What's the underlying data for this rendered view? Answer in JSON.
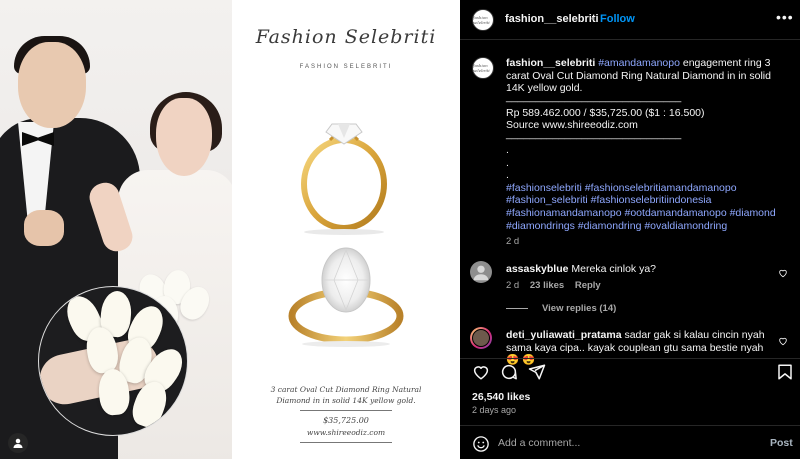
{
  "post": {
    "username": "fashion__selebriti",
    "follow_label": "Follow",
    "dot": "•",
    "more": "•••",
    "avatar_text": "fashion selebriti"
  },
  "media": {
    "brand_script": "Fashion Selebriti",
    "brand_sub": "FASHION SELEBRITI",
    "ring_caption_line1": "3 carat Oval Cut Diamond Ring Natural",
    "ring_caption_line2": "Diamond in in solid 14K yellow gold.",
    "price": "$35,725.00",
    "site": "www.shireeodiz.com"
  },
  "caption": {
    "username": "fashion__selebriti",
    "mention": "#amandamanopo",
    "text": " engagement ring 3 carat Oval Cut Diamond Ring Natural Diamond in in solid 14K yellow gold.",
    "rule1": "______________________________",
    "price_line": "Rp 589.462.000 / $35,725.00 ($1 : 16.500)",
    "source_line": "Source www.shireeodiz.com",
    "rule2": "______________________________",
    "dot1": ".",
    "dot2": ".",
    "dot3": ".",
    "hashtags_line1": "#fashionselebriti #fashionselebritiamandamanopo",
    "hashtags_line2": "#fashion_selebriti #fashionselebritiindonesia",
    "hashtags_line3": "#fashionamandamanopo #ootdamandamanopo #diamond",
    "hashtags_line4": "#diamondrings #diamondring #ovaldiamondring",
    "age": "2 d"
  },
  "comments": [
    {
      "username": "assaskyblue",
      "text": "Mereka cinlok ya?",
      "age": "2 d",
      "likes": "23 likes",
      "reply": "Reply",
      "avatar_color": "#8e8e8e"
    },
    {
      "username": "deti_yuliawati_pratama",
      "text": "sadar gak si kalau cincin nyah sama kaya cipa.. kayak couplean gtu sama bestie nyah 😍 😍",
      "avatar_color": "#c13584"
    }
  ],
  "view_replies": "View replies (14)",
  "likes": "26,540 likes",
  "posted_ago": "2 days ago",
  "add_comment": {
    "placeholder": "Add a comment...",
    "post_label": "Post"
  },
  "colors": {
    "accent": "#0095f6",
    "hashtag": "#8fa8ff",
    "background": "#000000"
  },
  "icons": [
    "heart-icon",
    "comment-icon",
    "share-icon",
    "bookmark-icon",
    "emoji-icon",
    "more-icon",
    "user-icon"
  ]
}
